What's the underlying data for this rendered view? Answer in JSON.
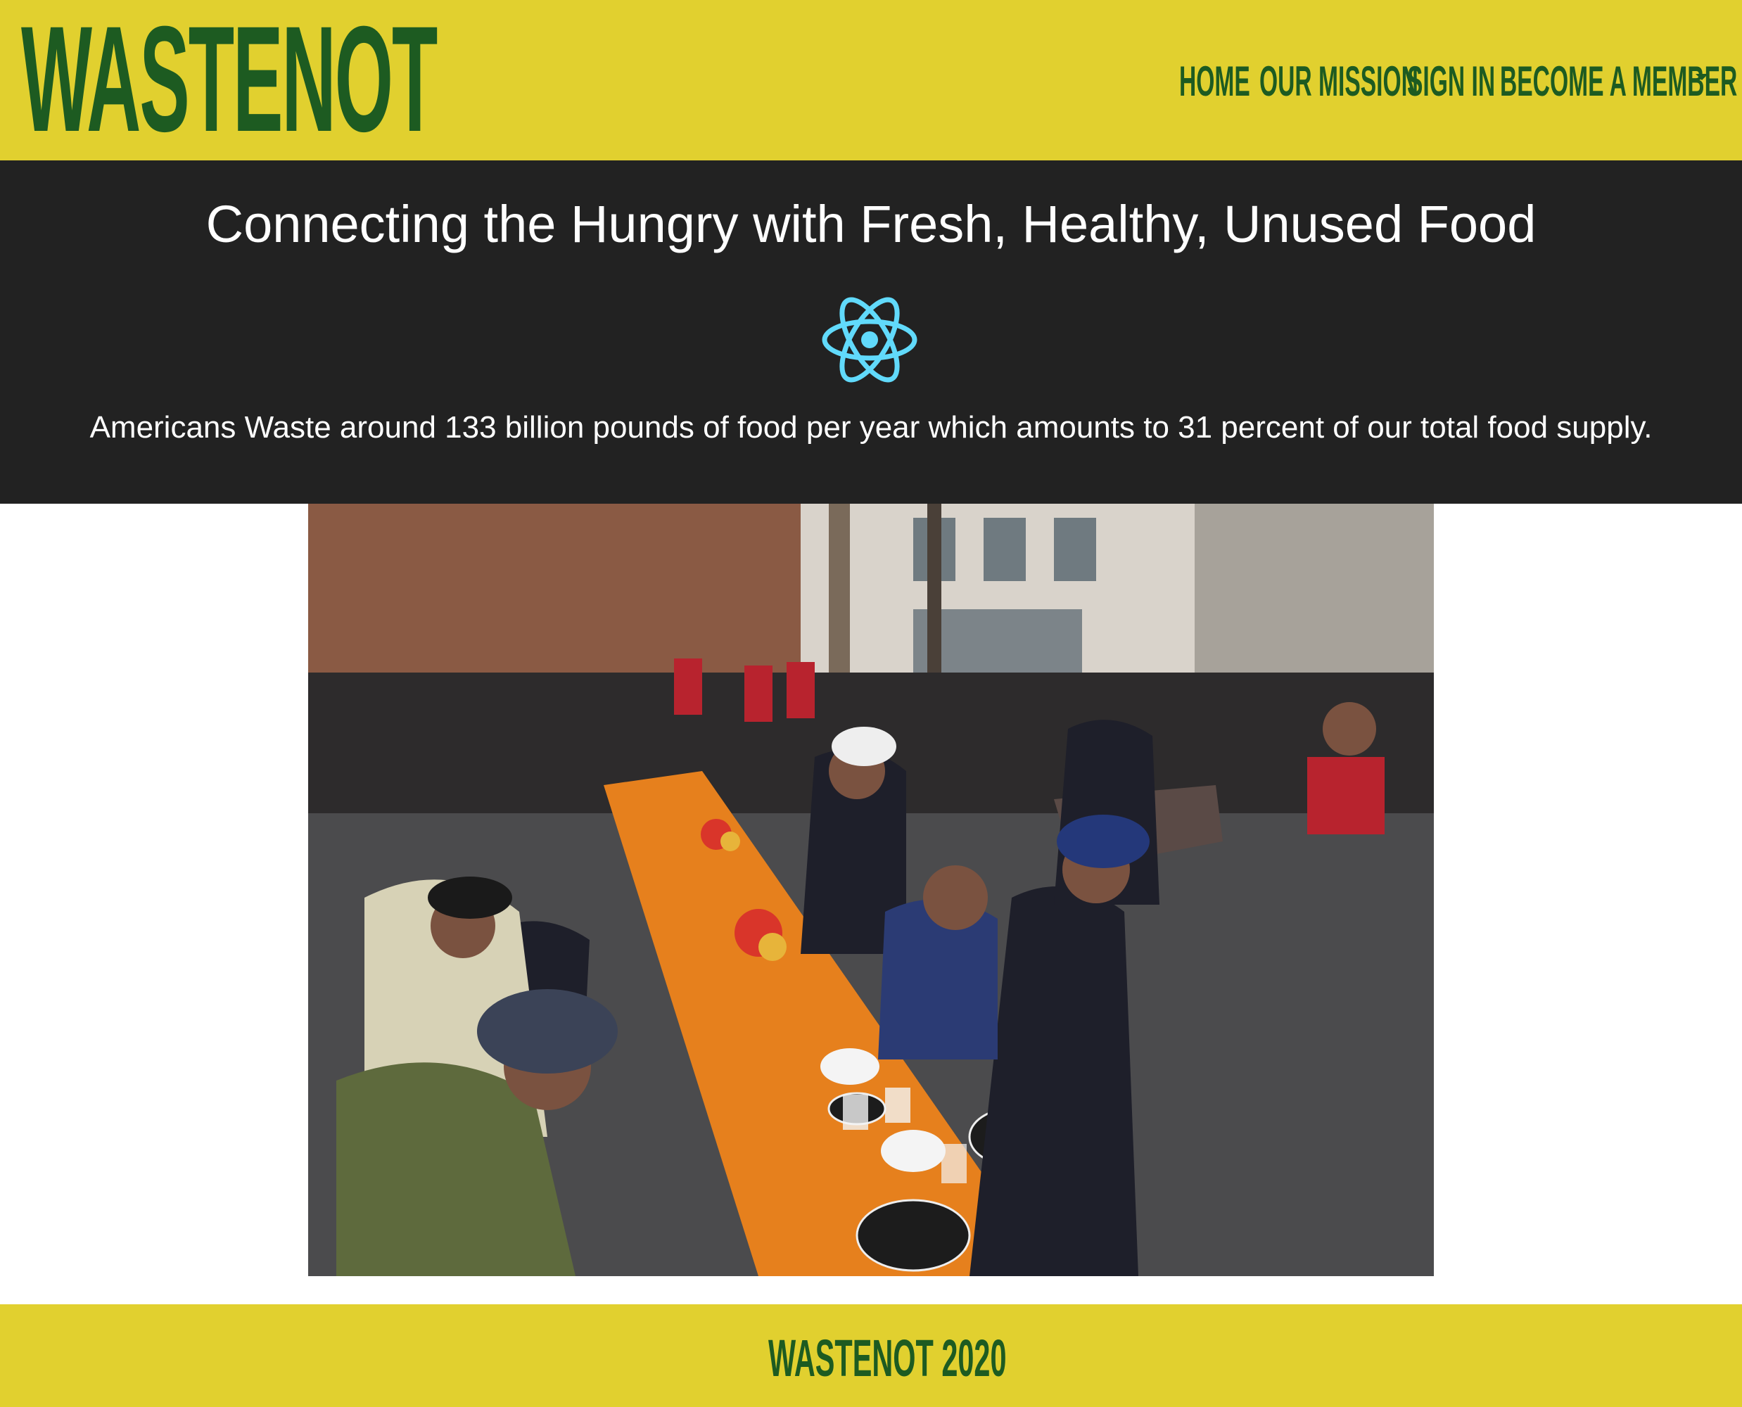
{
  "navbar": {
    "brand": "WASTENOT",
    "links": {
      "home": "HOME",
      "mission": "OUR MISSION",
      "signin": "SIGN IN",
      "member": "BECOME A MEMBER"
    },
    "icons": {
      "member_dropdown": "caret-down-icon"
    }
  },
  "hero": {
    "title": "Connecting the Hungry with Fresh, Healthy, Unused Food",
    "logo_icon": "react-atom-icon",
    "text": "Americans Waste around 133 billion pounds of food per year which amounts to 31 percent of our total food supply."
  },
  "photo": {
    "subject": "people sharing a meal at long outdoor tables on a city street"
  },
  "footer": {
    "text": "WASTENOT 2020"
  },
  "colors": {
    "brand_yellow": "#e1d02f",
    "brand_green": "#1d5b21",
    "hero_dark": "#222222",
    "react_blue": "#61dafb"
  }
}
